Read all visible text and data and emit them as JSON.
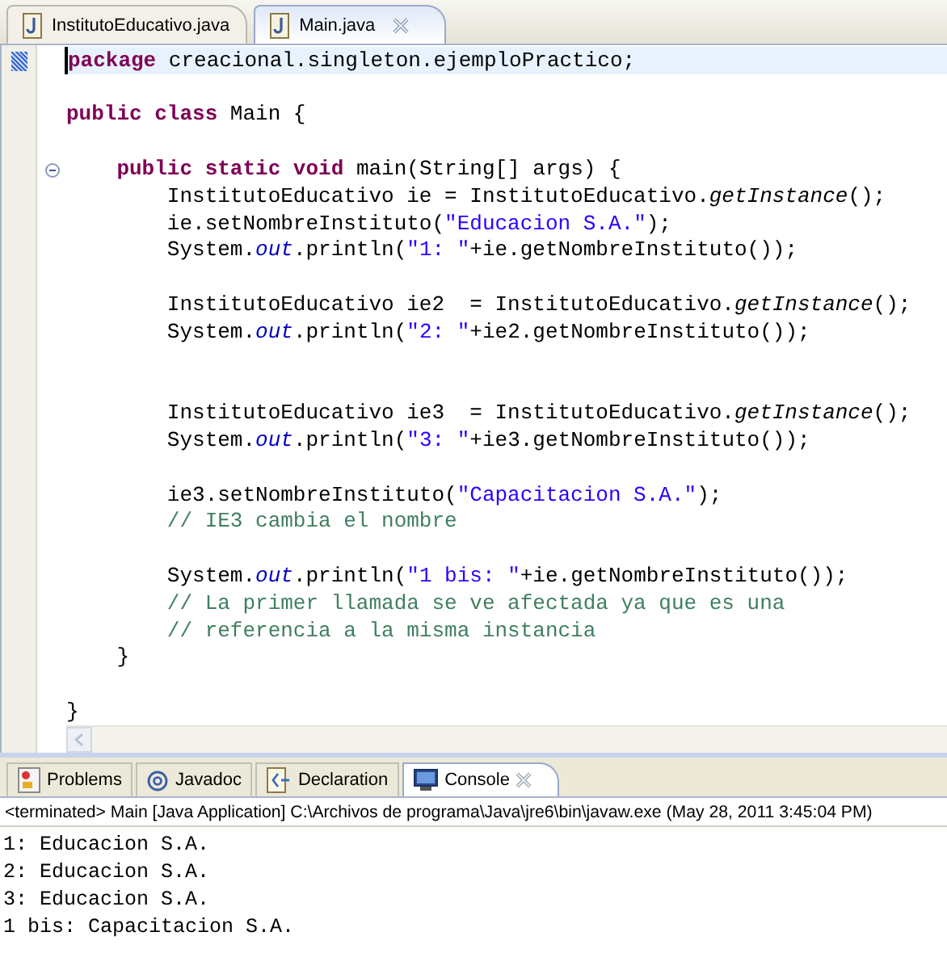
{
  "editor_tabs": [
    {
      "label": "InstitutoEducativo.java",
      "selected": false,
      "closable": false
    },
    {
      "label": "Main.java",
      "selected": true,
      "closable": true
    }
  ],
  "code_lines": [
    {
      "kind": "code",
      "current": true,
      "tokens": [
        {
          "t": "package",
          "kind": "keyword"
        },
        {
          "t": " creacional.singleton.ejemploPractico;",
          "kind": "plain"
        }
      ]
    },
    {
      "kind": "blank"
    },
    {
      "kind": "code",
      "current": false,
      "tokens": [
        {
          "t": "public class",
          "kind": "keyword"
        },
        {
          "t": " Main {",
          "kind": "plain"
        }
      ]
    },
    {
      "kind": "blank"
    },
    {
      "kind": "fold",
      "expanded": true,
      "current": false,
      "tokens": [
        {
          "t": "    public static void",
          "kind": "keyword"
        },
        {
          "t": " main(String[] args) {",
          "kind": "plain"
        }
      ]
    },
    {
      "kind": "code",
      "current": false,
      "tokens": [
        {
          "t": "        InstitutoEducativo ie = InstitutoEducativo.",
          "kind": "plain"
        },
        {
          "t": "getInstance",
          "kind": "static_method"
        },
        {
          "t": "();",
          "kind": "plain"
        }
      ]
    },
    {
      "kind": "code",
      "current": false,
      "tokens": [
        {
          "t": "        ie.setNombreInstituto(",
          "kind": "plain"
        },
        {
          "t": "\"Educacion S.A.\"",
          "kind": "string"
        },
        {
          "t": ");",
          "kind": "plain"
        }
      ]
    },
    {
      "kind": "code",
      "current": false,
      "tokens": [
        {
          "t": "        System.",
          "kind": "plain"
        },
        {
          "t": "out",
          "kind": "static_field"
        },
        {
          "t": ".println(",
          "kind": "plain"
        },
        {
          "t": "\"1: \"",
          "kind": "string"
        },
        {
          "t": "+ie.getNombreInstituto());",
          "kind": "plain"
        }
      ]
    },
    {
      "kind": "blank"
    },
    {
      "kind": "code",
      "current": false,
      "tokens": [
        {
          "t": "        InstitutoEducativo ie2  = InstitutoEducativo.",
          "kind": "plain"
        },
        {
          "t": "getInstance",
          "kind": "static_method"
        },
        {
          "t": "();",
          "kind": "plain"
        }
      ]
    },
    {
      "kind": "code",
      "current": false,
      "tokens": [
        {
          "t": "        System.",
          "kind": "plain"
        },
        {
          "t": "out",
          "kind": "static_field"
        },
        {
          "t": ".println(",
          "kind": "plain"
        },
        {
          "t": "\"2: \"",
          "kind": "string"
        },
        {
          "t": "+ie2.getNombreInstituto());",
          "kind": "plain"
        }
      ]
    },
    {
      "kind": "blank"
    },
    {
      "kind": "blank"
    },
    {
      "kind": "code",
      "current": false,
      "tokens": [
        {
          "t": "        InstitutoEducativo ie3  = InstitutoEducativo.",
          "kind": "plain"
        },
        {
          "t": "getInstance",
          "kind": "static_method"
        },
        {
          "t": "();",
          "kind": "plain"
        }
      ]
    },
    {
      "kind": "code",
      "current": false,
      "tokens": [
        {
          "t": "        System.",
          "kind": "plain"
        },
        {
          "t": "out",
          "kind": "static_field"
        },
        {
          "t": ".println(",
          "kind": "plain"
        },
        {
          "t": "\"3: \"",
          "kind": "string"
        },
        {
          "t": "+ie3.getNombreInstituto());",
          "kind": "plain"
        }
      ]
    },
    {
      "kind": "blank"
    },
    {
      "kind": "code",
      "current": false,
      "tokens": [
        {
          "t": "        ie3.setNombreInstituto(",
          "kind": "plain"
        },
        {
          "t": "\"Capacitacion S.A.\"",
          "kind": "string"
        },
        {
          "t": ");",
          "kind": "plain"
        }
      ]
    },
    {
      "kind": "code",
      "current": false,
      "tokens": [
        {
          "t": "        // IE3 cambia el nombre",
          "kind": "comment"
        }
      ]
    },
    {
      "kind": "blank"
    },
    {
      "kind": "code",
      "current": false,
      "tokens": [
        {
          "t": "        System.",
          "kind": "plain"
        },
        {
          "t": "out",
          "kind": "static_field"
        },
        {
          "t": ".println(",
          "kind": "plain"
        },
        {
          "t": "\"1 bis: \"",
          "kind": "string"
        },
        {
          "t": "+ie.getNombreInstituto());",
          "kind": "plain"
        }
      ]
    },
    {
      "kind": "code",
      "current": false,
      "tokens": [
        {
          "t": "        // La primer llamada se ve afectada ya que es una",
          "kind": "comment"
        }
      ]
    },
    {
      "kind": "code",
      "current": false,
      "tokens": [
        {
          "t": "        // referencia a la misma instancia",
          "kind": "comment"
        }
      ]
    },
    {
      "kind": "code",
      "current": false,
      "tokens": [
        {
          "t": "    }",
          "kind": "plain"
        }
      ]
    },
    {
      "kind": "blank"
    },
    {
      "kind": "code",
      "current": false,
      "tokens": [
        {
          "t": "}",
          "kind": "plain"
        }
      ]
    }
  ],
  "panel_tabs": [
    {
      "label": "Problems",
      "kind": "problems",
      "selected": false,
      "closable": false
    },
    {
      "label": "Javadoc",
      "kind": "javadoc",
      "selected": false,
      "closable": false
    },
    {
      "label": "Declaration",
      "kind": "declaration",
      "selected": false,
      "closable": false
    },
    {
      "label": "Console",
      "kind": "console",
      "selected": true,
      "closable": true
    }
  ],
  "console": {
    "header": "<terminated> Main [Java Application] C:\\Archivos de programa\\Java\\jre6\\bin\\javaw.exe (May 28, 2011 3:45:04 PM)",
    "output": [
      "1: Educacion S.A.",
      "2: Educacion S.A.",
      "3: Educacion S.A.",
      "1 bis: Capacitacion S.A."
    ]
  }
}
